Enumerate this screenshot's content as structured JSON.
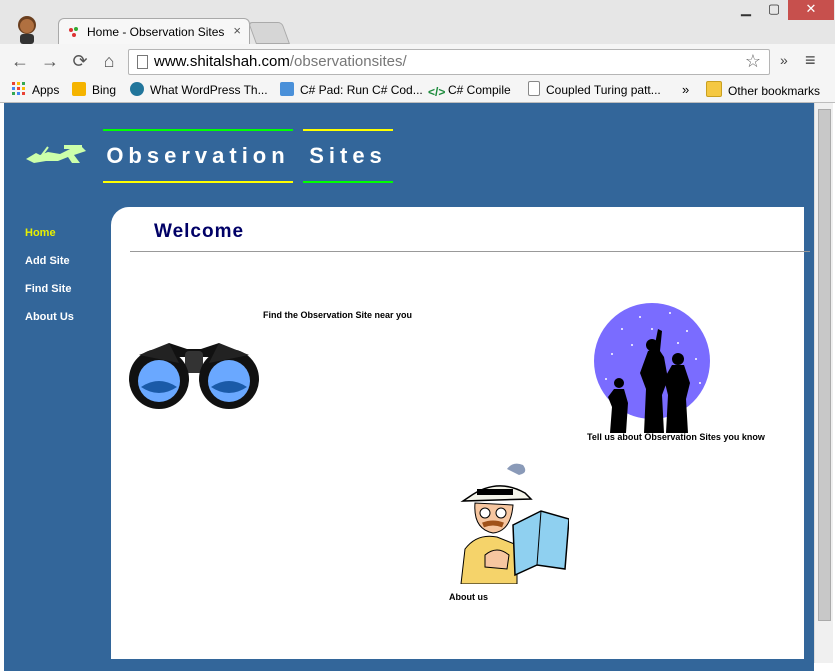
{
  "browser": {
    "tab_title": "Home - Observation Sites",
    "tab_close": "×",
    "window": {
      "minimize": "▁",
      "maximize": "▢",
      "close": "✕"
    },
    "url_host": "www.shitalshah.com",
    "url_path": "/observationsites/",
    "nav": {
      "back": "←",
      "forward": "→",
      "reload": "⟳",
      "home": "⌂"
    },
    "extensions_more": "»",
    "menu": "≡",
    "bookmarks": [
      {
        "label": "Apps",
        "icon": "apps-grid-icon",
        "color": "#e94235"
      },
      {
        "label": "Bing",
        "icon": "bing-icon",
        "color": "#f5b400"
      },
      {
        "label": "What WordPress Th...",
        "icon": "wordpress-icon",
        "color": "#21759b"
      },
      {
        "label": "C# Pad: Run C# Cod...",
        "icon": "csharp-pad-icon",
        "color": "#4a90d9"
      },
      {
        "label": "C# Compile",
        "icon": "code-icon",
        "color": "#1a8a3a"
      },
      {
        "label": "Coupled Turing patt...",
        "icon": "page-icon",
        "color": "#ffffff"
      }
    ],
    "bookmarks_more": "»",
    "other_bookmarks": "Other bookmarks"
  },
  "site": {
    "header_words": [
      "Observation",
      "Sites"
    ],
    "nav": [
      {
        "label": "Home",
        "active": true
      },
      {
        "label": "Add Site",
        "active": false
      },
      {
        "label": "Find Site",
        "active": false
      },
      {
        "label": "About Us",
        "active": false
      }
    ],
    "welcome": "Welcome",
    "captions": {
      "find": "Find the Observation Site near you",
      "tell": "Tell us about Observation Sites you know",
      "about": "About us"
    }
  },
  "colors": {
    "page_bg": "#33669a",
    "active_nav": "#e8f000",
    "welcome": "#000066",
    "accent_green": "#00ff00",
    "accent_yellow": "#ffff00"
  }
}
